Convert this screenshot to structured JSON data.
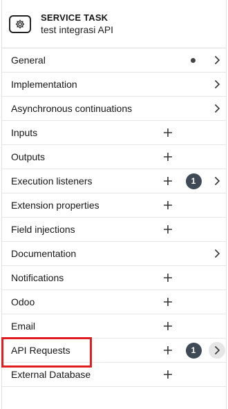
{
  "header": {
    "element_type": "SERVICE TASK",
    "element_name": "test integrasi API",
    "icon": "gear-icon"
  },
  "groups": [
    {
      "id": "general",
      "label": "General",
      "dot": true,
      "plus": false,
      "badge": "",
      "chevron": true
    },
    {
      "id": "implementation",
      "label": "Implementation",
      "dot": false,
      "plus": false,
      "badge": "",
      "chevron": true
    },
    {
      "id": "async",
      "label": "Asynchronous continuations",
      "dot": false,
      "plus": false,
      "badge": "",
      "chevron": true
    },
    {
      "id": "inputs",
      "label": "Inputs",
      "dot": false,
      "plus": true,
      "badge": "",
      "chevron": false
    },
    {
      "id": "outputs",
      "label": "Outputs",
      "dot": false,
      "plus": true,
      "badge": "",
      "chevron": false
    },
    {
      "id": "execution-listeners",
      "label": "Execution listeners",
      "dot": false,
      "plus": true,
      "badge": "1",
      "chevron": true
    },
    {
      "id": "extension-properties",
      "label": "Extension properties",
      "dot": false,
      "plus": true,
      "badge": "",
      "chevron": false
    },
    {
      "id": "field-injections",
      "label": "Field injections",
      "dot": false,
      "plus": true,
      "badge": "",
      "chevron": false
    },
    {
      "id": "documentation",
      "label": "Documentation",
      "dot": false,
      "plus": false,
      "badge": "",
      "chevron": true
    },
    {
      "id": "notifications",
      "label": "Notifications",
      "dot": false,
      "plus": true,
      "badge": "",
      "chevron": false
    },
    {
      "id": "odoo",
      "label": "Odoo",
      "dot": false,
      "plus": true,
      "badge": "",
      "chevron": false
    },
    {
      "id": "email",
      "label": "Email",
      "dot": false,
      "plus": true,
      "badge": "",
      "chevron": false
    },
    {
      "id": "api-requests",
      "label": "API Requests",
      "dot": false,
      "plus": true,
      "badge": "1",
      "chevron": true,
      "active": true
    },
    {
      "id": "external-database",
      "label": "External Database",
      "dot": false,
      "plus": true,
      "badge": "",
      "chevron": false
    }
  ],
  "colors": {
    "badge_bg": "#3f4a57",
    "highlight_border": "#e11d22",
    "divider": "#e6e6e6"
  }
}
